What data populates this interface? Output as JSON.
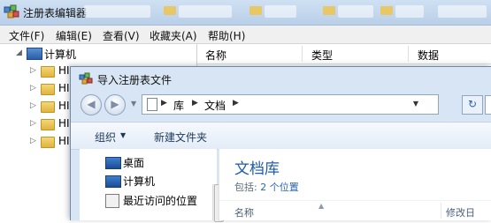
{
  "registry": {
    "title": "注册表编辑器",
    "menu": [
      "文件(F)",
      "编辑(E)",
      "查看(V)",
      "收藏夹(A)",
      "帮助(H)"
    ],
    "tree": {
      "root_label": "计算机",
      "children": [
        "HI",
        "HI",
        "HI",
        "HI",
        "HI"
      ]
    },
    "columns": {
      "name": "名称",
      "type": "类型",
      "data": "数据"
    }
  },
  "dialog": {
    "title": "导入注册表文件",
    "breadcrumb": [
      "库",
      "文档"
    ],
    "toolbar": {
      "organize": "组织",
      "new_folder": "新建文件夹"
    },
    "nav_items": [
      "桌面",
      "计算机",
      "最近访问的位置"
    ],
    "library": {
      "title": "文档库",
      "includes_label": "包括:",
      "locations_link": "2 个位置"
    },
    "columns": {
      "name": "名称",
      "modified": "修改日"
    }
  },
  "colors": {
    "titlebar": "#cfe0f3",
    "dialog_frame": "#d7e5f5",
    "library_title": "#1e5ba8",
    "link": "#2a64b3",
    "folder": "#e8c766"
  },
  "icons": [
    "regedit-icon",
    "computer-icon",
    "folder-icon",
    "back-icon",
    "forward-icon",
    "document-icon",
    "refresh-icon",
    "desktop-icon",
    "recent-places-icon"
  ]
}
